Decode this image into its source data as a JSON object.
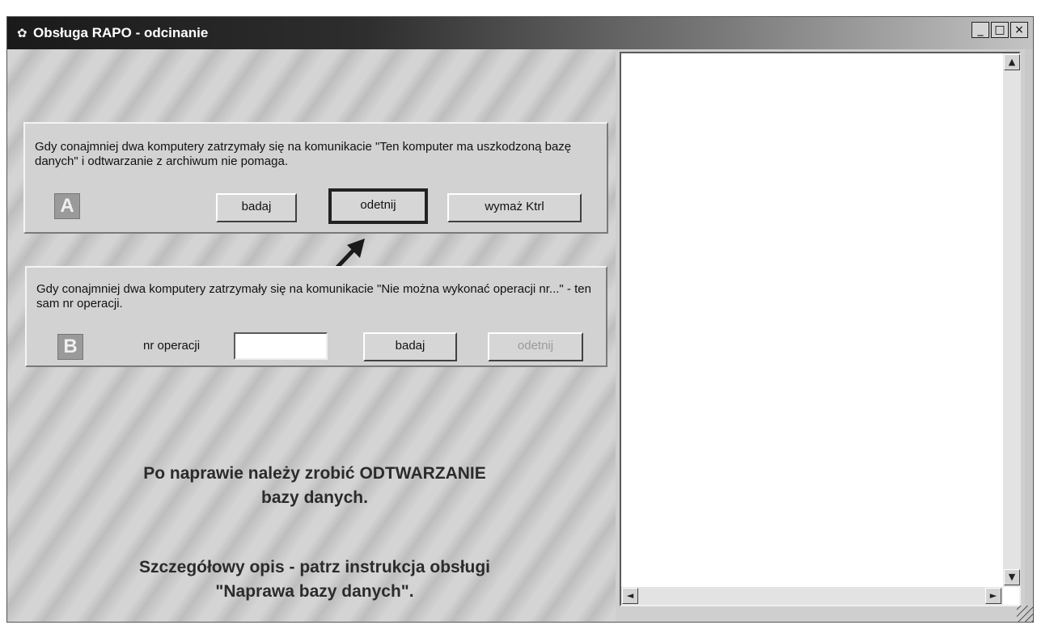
{
  "window": {
    "title": "Obsługa RAPO - odcinanie",
    "controls": {
      "minimize": "_",
      "maximize": "□",
      "close": "×"
    }
  },
  "section_a": {
    "badge": "A",
    "description": "Gdy conajmniej dwa komputery zatrzymały się na komunikacie \"Ten komputer ma uszkodzoną bazę danych\" i odtwarzanie z archiwum nie pomaga.",
    "buttons": {
      "badaj": "badaj",
      "odetnij": "odetnij",
      "wymaz": "wymaż Ktrl"
    }
  },
  "section_b": {
    "badge": "B",
    "description": "Gdy conajmniej dwa komputery zatrzymały się na komunikacie \"Nie można wykonać operacji nr...\" - ten sam nr operacji.",
    "nr_label": "nr operacji",
    "nr_value": "",
    "buttons": {
      "badaj": "badaj",
      "odetnij": "odetnij"
    }
  },
  "notes": {
    "line1": "Po naprawie należy zrobić ODTWARZANIE",
    "line2": "bazy danych.",
    "line3": "Szczegółowy opis - patrz instrukcja obsługi",
    "line4": "\"Naprawa bazy danych\"."
  },
  "scroll_glyphs": {
    "up": "▲",
    "down": "▼",
    "left": "◄",
    "right": "►"
  },
  "icons": {
    "title": "app-icon",
    "arrow": "pointer-arrow-icon"
  }
}
